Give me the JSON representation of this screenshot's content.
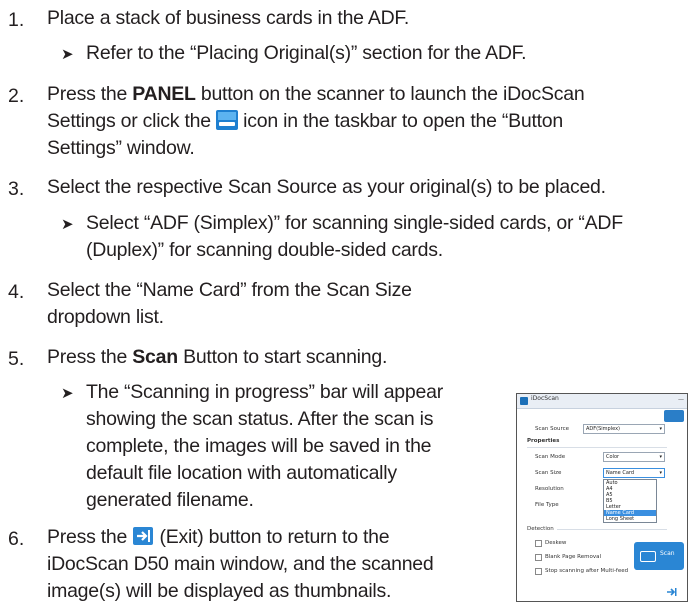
{
  "steps": [
    {
      "num": "1.",
      "line1": "Place a stack of business cards in the ADF."
    },
    {
      "num": "2.",
      "pre": "Press the ",
      "bold": "PANEL",
      "post": " button on the scanner to launch the iDocScan",
      "line2_pre": "Settings or click the ",
      "line2_post": " icon in the taskbar to open the “Button",
      "line3": "Settings” window."
    },
    {
      "num": "3.",
      "line1": "Select the respective Scan Source as your original(s) to be placed."
    },
    {
      "num": "4.",
      "line1": "Select the “Name Card” from the Scan Size",
      "line2": "dropdown list."
    },
    {
      "num": "5.",
      "pre": "Press the ",
      "bold": "Scan",
      "post": " Button to start scanning."
    },
    {
      "num": "6.",
      "pre": "Press the ",
      "post": " (Exit) button to return to the",
      "line2": "iDocScan D50 main window, and the scanned",
      "line3": "image(s) will be displayed as thumbnails."
    }
  ],
  "subs": {
    "s1": "Refer to the “Placing Original(s)” section for the ADF.",
    "s3_l1": "Select “ADF (Simplex)” for scanning single-sided cards, or “ADF",
    "s3_l2": "(Duplex)” for scanning double-sided cards.",
    "s5_l1": "The “Scanning in progress” bar will appear",
    "s5_l2": "showing the scan status. After the scan is",
    "s5_l3": "complete, the images will be saved in the",
    "s5_l4": "default file location with automatically",
    "s5_l5": "generated filename."
  },
  "arrow_glyph": "➤",
  "window": {
    "title": "iDocScan",
    "scan_source_label": "Scan Source",
    "scan_source_value": "ADF(Simplex)",
    "properties_label": "Properties",
    "scan_mode_label": "Scan Mode",
    "scan_mode_value": "Color",
    "scan_size_label": "Scan Size",
    "scan_size_value": "Name Card",
    "resolution_label": "Resolution",
    "file_type_label": "File Type",
    "size_options": [
      "Auto",
      "A4",
      "A5",
      "B5",
      "Letter",
      "Name Card",
      "Long Sheet"
    ],
    "detection_label": "Detection",
    "opt_doskew": "Deskew",
    "opt_blank": "Blank Page Removal",
    "opt_multifeed": "Stop scanning after Multi-feed",
    "scan_button": "Scan"
  },
  "colors": {
    "text": "#231f20",
    "accent": "#2a86d4"
  }
}
